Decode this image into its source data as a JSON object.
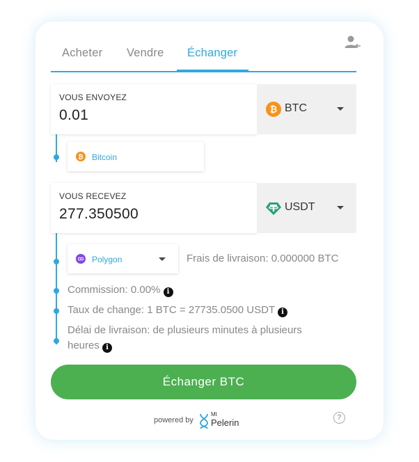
{
  "tabs": [
    {
      "label": "Acheter"
    },
    {
      "label": "Vendre"
    },
    {
      "label": "Échanger",
      "active": true
    }
  ],
  "send": {
    "label": "VOUS ENVOYEZ",
    "amount": "0.01",
    "currency": "BTC",
    "currency_icon": "bitcoin-icon",
    "network": "Bitcoin",
    "network_icon": "bitcoin-icon"
  },
  "receive": {
    "label": "VOUS RECEVEZ",
    "amount": "277.350500",
    "currency": "USDT",
    "currency_icon": "tether-icon",
    "network": "Polygon",
    "network_icon": "polygon-icon",
    "delivery_fee": "Frais de livraison: 0.000000 BTC"
  },
  "details": {
    "commission": "Commission: 0.00%",
    "rate": "Taux de change: 1 BTC = 27735.0500 USDT",
    "delay_line1": "Délai de livraison: de plusieurs minutes à plusieurs",
    "delay_line2": "heures"
  },
  "cta_label": "Échanger BTC",
  "footer": {
    "powered_by": "powered by",
    "brand_small": "Mt",
    "brand": "Pelerin"
  },
  "colors": {
    "accent": "#2fa8e0",
    "cta": "#4caf50",
    "bitcoin": "#f7931a",
    "tether": "#26a17b",
    "polygon": "#8247e5"
  }
}
